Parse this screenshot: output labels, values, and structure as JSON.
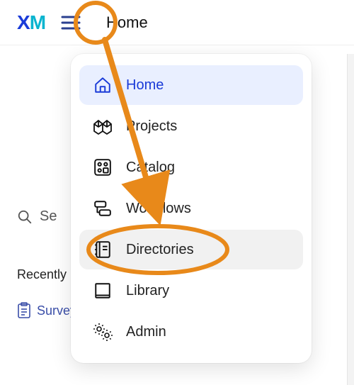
{
  "header": {
    "logo_x": "X",
    "logo_m": "M",
    "title": "Home"
  },
  "menu": {
    "items": [
      {
        "key": "home",
        "label": "Home",
        "active": true
      },
      {
        "key": "projects",
        "label": "Projects"
      },
      {
        "key": "catalog",
        "label": "Catalog"
      },
      {
        "key": "workflows",
        "label": "Workflows"
      },
      {
        "key": "directories",
        "label": "Directories",
        "highlighted": true
      },
      {
        "key": "library",
        "label": "Library"
      },
      {
        "key": "admin",
        "label": "Admin"
      }
    ]
  },
  "page": {
    "search_partial": "Se",
    "recent_label": "Recently",
    "survey_partial": "Survey"
  },
  "annotation": {
    "color": "#e8891a"
  }
}
